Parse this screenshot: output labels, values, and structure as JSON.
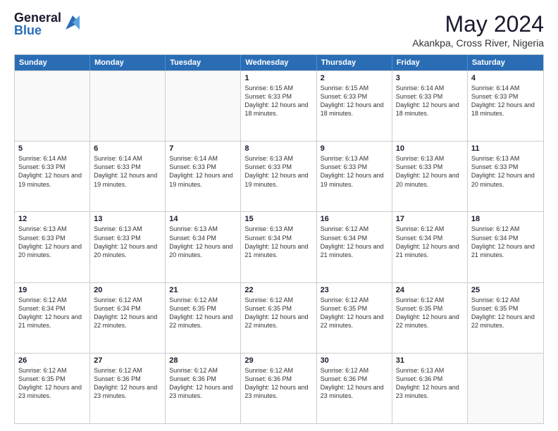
{
  "logo": {
    "general": "General",
    "blue": "Blue"
  },
  "title": {
    "month_year": "May 2024",
    "location": "Akankpa, Cross River, Nigeria"
  },
  "days_of_week": [
    "Sunday",
    "Monday",
    "Tuesday",
    "Wednesday",
    "Thursday",
    "Friday",
    "Saturday"
  ],
  "weeks": [
    [
      {
        "day": "",
        "info": ""
      },
      {
        "day": "",
        "info": ""
      },
      {
        "day": "",
        "info": ""
      },
      {
        "day": "1",
        "info": "Sunrise: 6:15 AM\nSunset: 6:33 PM\nDaylight: 12 hours and 18 minutes."
      },
      {
        "day": "2",
        "info": "Sunrise: 6:15 AM\nSunset: 6:33 PM\nDaylight: 12 hours and 18 minutes."
      },
      {
        "day": "3",
        "info": "Sunrise: 6:14 AM\nSunset: 6:33 PM\nDaylight: 12 hours and 18 minutes."
      },
      {
        "day": "4",
        "info": "Sunrise: 6:14 AM\nSunset: 6:33 PM\nDaylight: 12 hours and 18 minutes."
      }
    ],
    [
      {
        "day": "5",
        "info": "Sunrise: 6:14 AM\nSunset: 6:33 PM\nDaylight: 12 hours and 19 minutes."
      },
      {
        "day": "6",
        "info": "Sunrise: 6:14 AM\nSunset: 6:33 PM\nDaylight: 12 hours and 19 minutes."
      },
      {
        "day": "7",
        "info": "Sunrise: 6:14 AM\nSunset: 6:33 PM\nDaylight: 12 hours and 19 minutes."
      },
      {
        "day": "8",
        "info": "Sunrise: 6:13 AM\nSunset: 6:33 PM\nDaylight: 12 hours and 19 minutes."
      },
      {
        "day": "9",
        "info": "Sunrise: 6:13 AM\nSunset: 6:33 PM\nDaylight: 12 hours and 19 minutes."
      },
      {
        "day": "10",
        "info": "Sunrise: 6:13 AM\nSunset: 6:33 PM\nDaylight: 12 hours and 20 minutes."
      },
      {
        "day": "11",
        "info": "Sunrise: 6:13 AM\nSunset: 6:33 PM\nDaylight: 12 hours and 20 minutes."
      }
    ],
    [
      {
        "day": "12",
        "info": "Sunrise: 6:13 AM\nSunset: 6:33 PM\nDaylight: 12 hours and 20 minutes."
      },
      {
        "day": "13",
        "info": "Sunrise: 6:13 AM\nSunset: 6:33 PM\nDaylight: 12 hours and 20 minutes."
      },
      {
        "day": "14",
        "info": "Sunrise: 6:13 AM\nSunset: 6:34 PM\nDaylight: 12 hours and 20 minutes."
      },
      {
        "day": "15",
        "info": "Sunrise: 6:13 AM\nSunset: 6:34 PM\nDaylight: 12 hours and 21 minutes."
      },
      {
        "day": "16",
        "info": "Sunrise: 6:12 AM\nSunset: 6:34 PM\nDaylight: 12 hours and 21 minutes."
      },
      {
        "day": "17",
        "info": "Sunrise: 6:12 AM\nSunset: 6:34 PM\nDaylight: 12 hours and 21 minutes."
      },
      {
        "day": "18",
        "info": "Sunrise: 6:12 AM\nSunset: 6:34 PM\nDaylight: 12 hours and 21 minutes."
      }
    ],
    [
      {
        "day": "19",
        "info": "Sunrise: 6:12 AM\nSunset: 6:34 PM\nDaylight: 12 hours and 21 minutes."
      },
      {
        "day": "20",
        "info": "Sunrise: 6:12 AM\nSunset: 6:34 PM\nDaylight: 12 hours and 22 minutes."
      },
      {
        "day": "21",
        "info": "Sunrise: 6:12 AM\nSunset: 6:35 PM\nDaylight: 12 hours and 22 minutes."
      },
      {
        "day": "22",
        "info": "Sunrise: 6:12 AM\nSunset: 6:35 PM\nDaylight: 12 hours and 22 minutes."
      },
      {
        "day": "23",
        "info": "Sunrise: 6:12 AM\nSunset: 6:35 PM\nDaylight: 12 hours and 22 minutes."
      },
      {
        "day": "24",
        "info": "Sunrise: 6:12 AM\nSunset: 6:35 PM\nDaylight: 12 hours and 22 minutes."
      },
      {
        "day": "25",
        "info": "Sunrise: 6:12 AM\nSunset: 6:35 PM\nDaylight: 12 hours and 22 minutes."
      }
    ],
    [
      {
        "day": "26",
        "info": "Sunrise: 6:12 AM\nSunset: 6:35 PM\nDaylight: 12 hours and 23 minutes."
      },
      {
        "day": "27",
        "info": "Sunrise: 6:12 AM\nSunset: 6:36 PM\nDaylight: 12 hours and 23 minutes."
      },
      {
        "day": "28",
        "info": "Sunrise: 6:12 AM\nSunset: 6:36 PM\nDaylight: 12 hours and 23 minutes."
      },
      {
        "day": "29",
        "info": "Sunrise: 6:12 AM\nSunset: 6:36 PM\nDaylight: 12 hours and 23 minutes."
      },
      {
        "day": "30",
        "info": "Sunrise: 6:12 AM\nSunset: 6:36 PM\nDaylight: 12 hours and 23 minutes."
      },
      {
        "day": "31",
        "info": "Sunrise: 6:13 AM\nSunset: 6:36 PM\nDaylight: 12 hours and 23 minutes."
      },
      {
        "day": "",
        "info": ""
      }
    ]
  ]
}
